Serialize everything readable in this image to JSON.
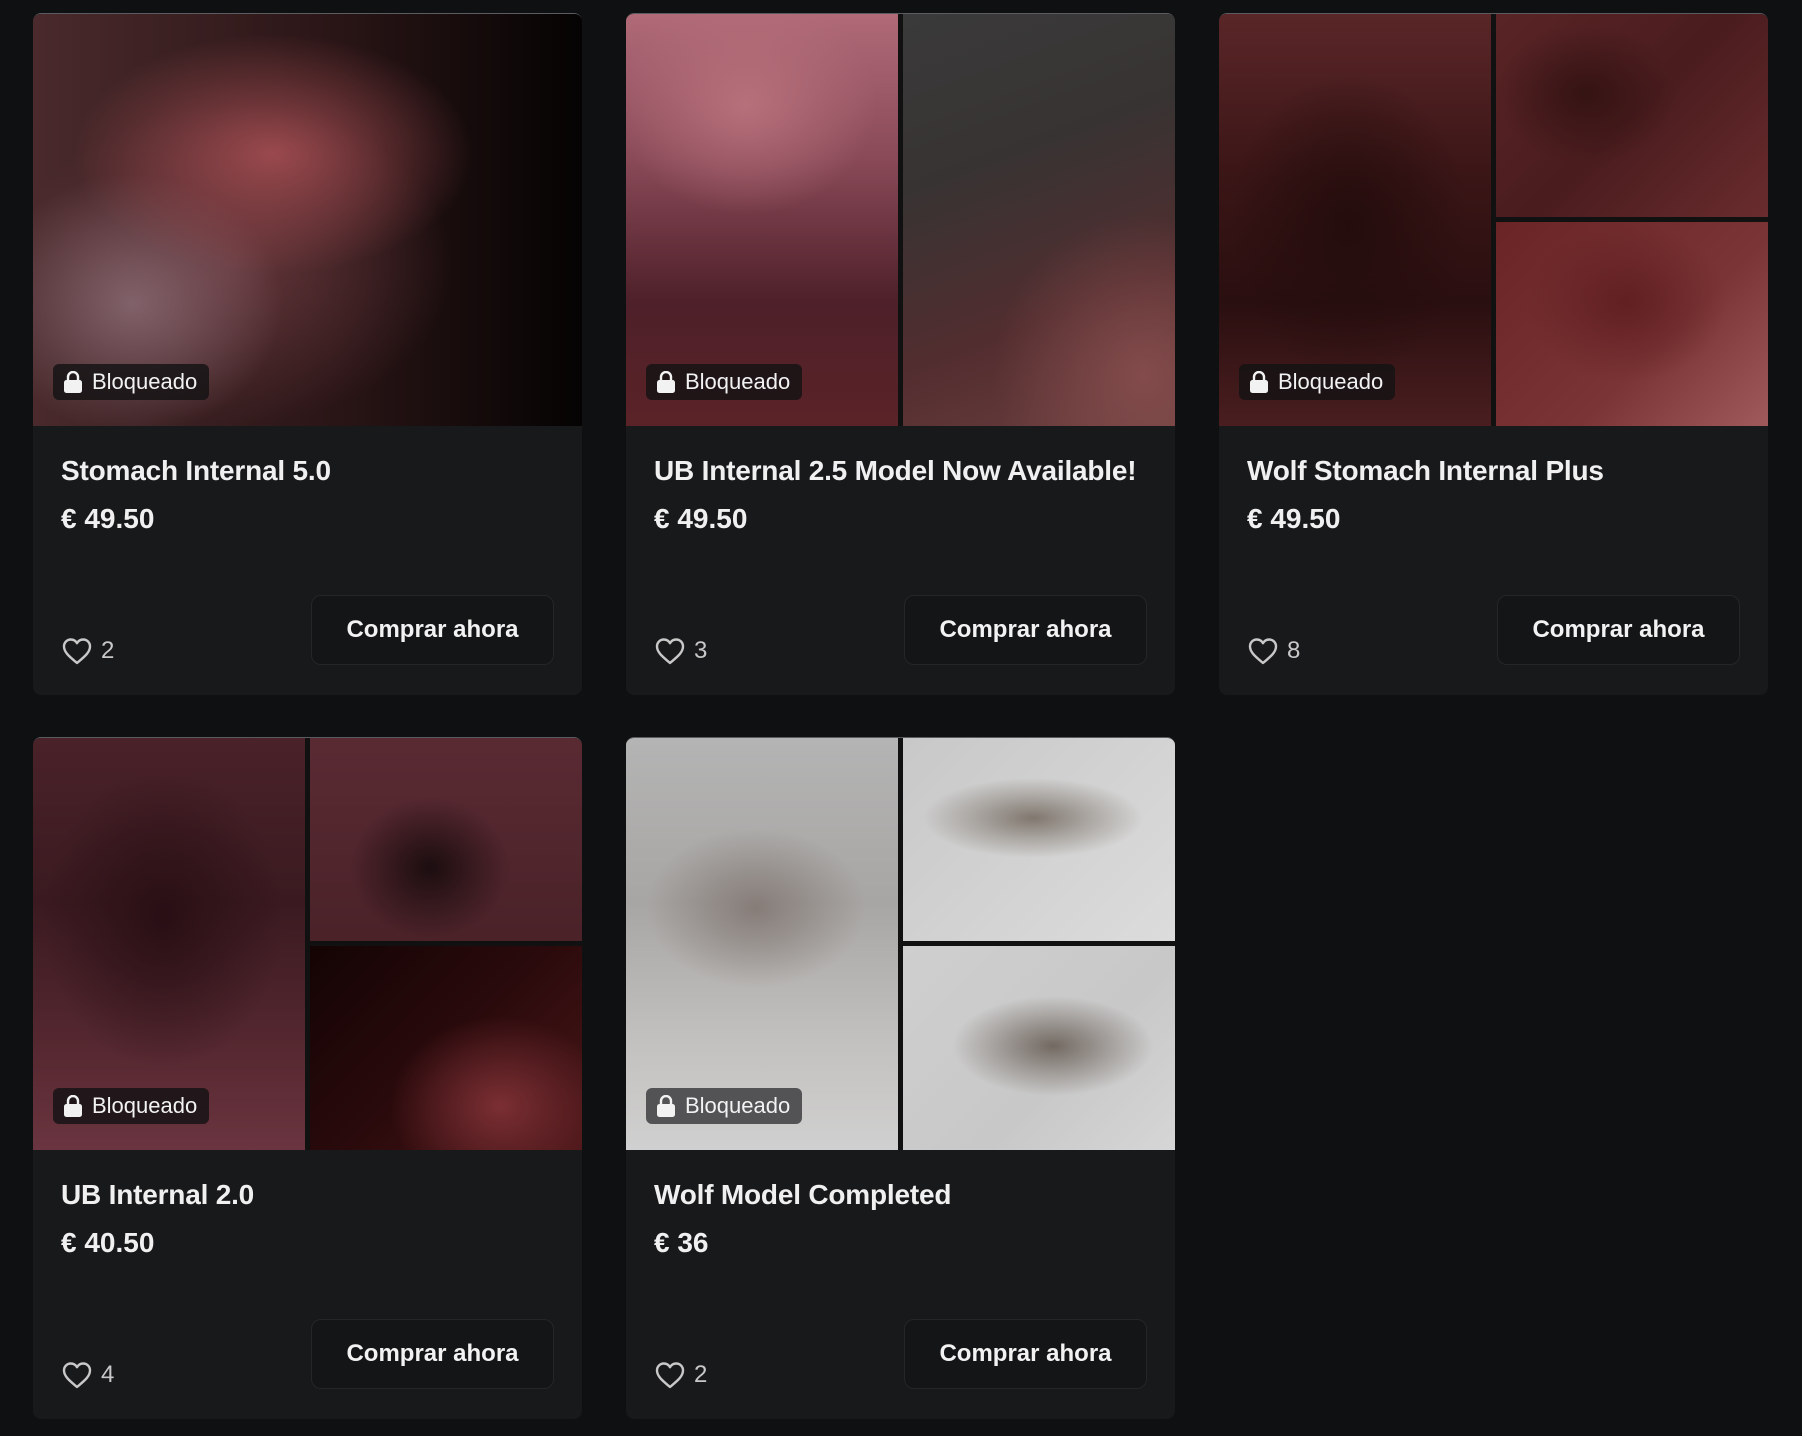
{
  "locked_label": "Bloqueado",
  "buy_label": "Comprar ahora",
  "products": [
    {
      "title": "Stomach Internal 5.0",
      "price": "€ 49.50",
      "likes": "2"
    },
    {
      "title": "UB Internal 2.5 Model Now Available!",
      "price": "€ 49.50",
      "likes": "3"
    },
    {
      "title": "Wolf Stomach Internal Plus",
      "price": "€ 49.50",
      "likes": "8"
    },
    {
      "title": "UB Internal 2.0",
      "price": "€ 40.50",
      "likes": "4"
    },
    {
      "title": "Wolf Model Completed",
      "price": "€ 36",
      "likes": "2"
    }
  ],
  "icons": {
    "lock": "lock-icon",
    "heart": "heart-outline-icon"
  },
  "colors": {
    "page_background": "#0e1011",
    "card_background": "#18191b",
    "text_primary": "#f0f0f0",
    "text_secondary": "#c8c8c8"
  }
}
